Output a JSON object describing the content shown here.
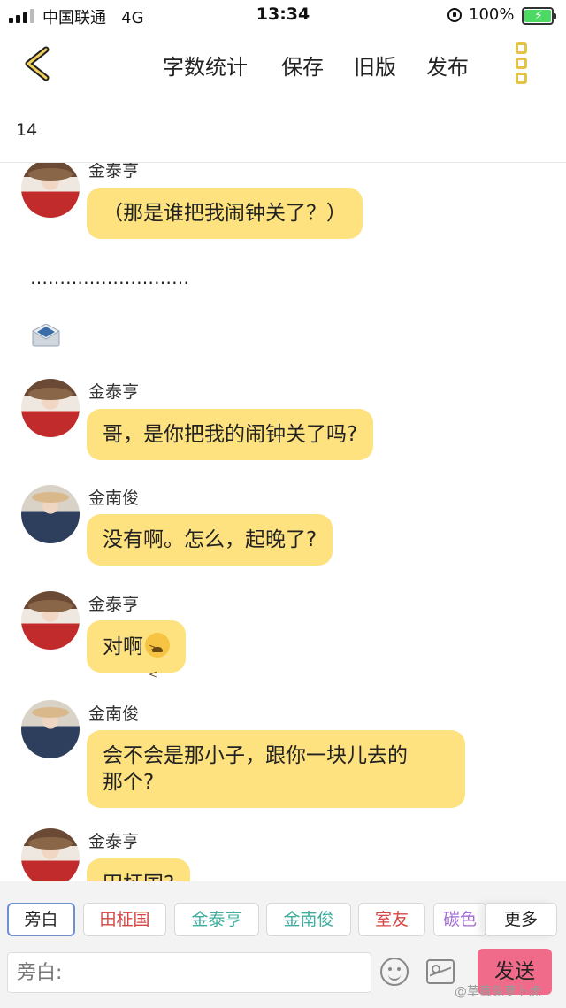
{
  "status": {
    "carrier": "中国联通",
    "network": "4G",
    "time": "13:34",
    "battery": "100%",
    "battery_level": 1.0
  },
  "toolbar": {
    "word_count": "字数统计",
    "save": "保存",
    "old_version": "旧版",
    "publish": "发布"
  },
  "word_count_value": "14",
  "messages": [
    {
      "speaker": "金泰亨",
      "text": "（那是谁把我闹钟关了？）"
    },
    {
      "speaker": "金泰亨",
      "text": "哥，是你把我的闹钟关了吗?"
    },
    {
      "speaker": "金南俊",
      "text": "没有啊。怎么，起晚了?"
    },
    {
      "speaker": "金泰亨",
      "text": "对啊"
    },
    {
      "speaker": "金南俊",
      "text": "会不会是那小子，跟你一块儿去的",
      "text_line2": "那个?"
    },
    {
      "speaker": "金泰亨",
      "text": "田柾国?"
    }
  ],
  "narration_dots": "………………………",
  "roles": [
    "旁白",
    "田柾国",
    "金泰亨",
    "金南俊",
    "室友",
    "碳色",
    "更多"
  ],
  "role_colors": {
    "田柾国": "#d64545",
    "金泰亨": "#3fae9e",
    "金南俊": "#3fae9e",
    "室友": "#d64545",
    "碳色": "#a06ad6"
  },
  "input": {
    "placeholder": "旁白:"
  },
  "send_label": "发送",
  "watermark": "@草莓兔萝卜虎"
}
